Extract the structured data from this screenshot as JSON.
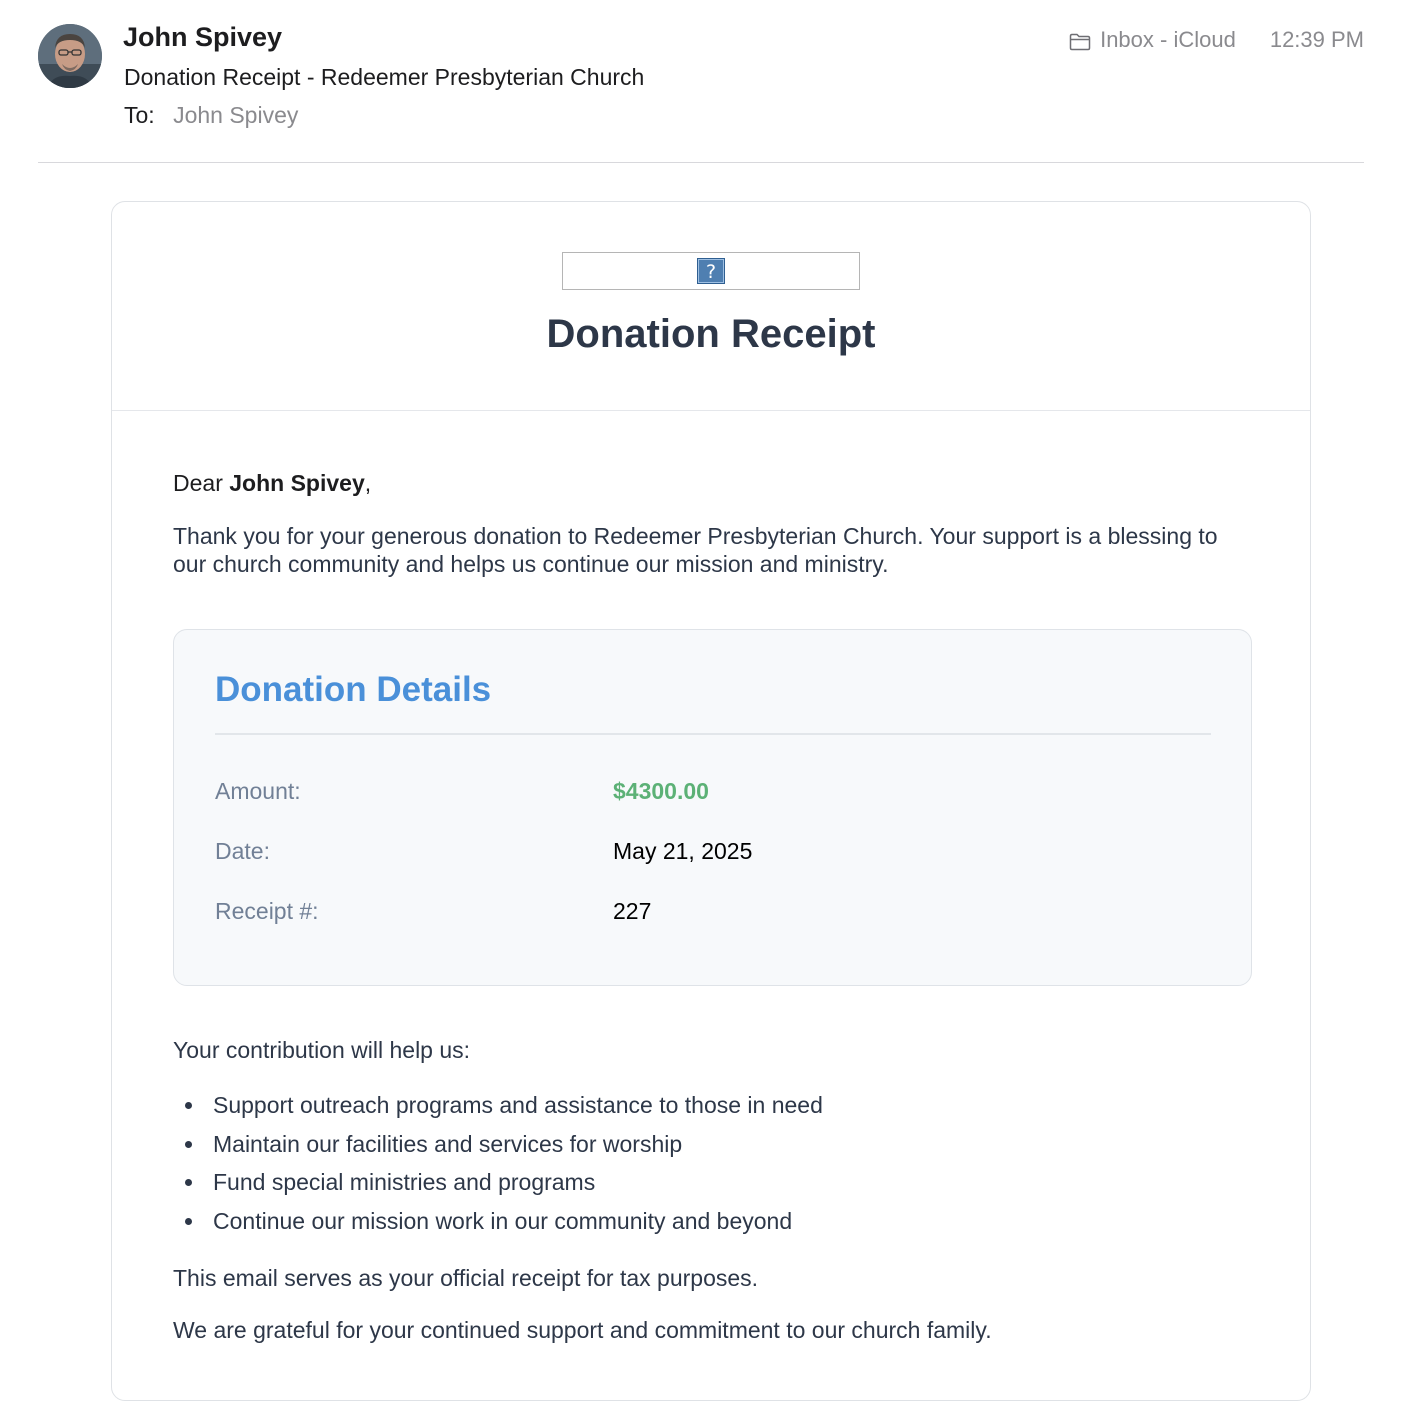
{
  "message": {
    "sender_name": "John Spivey",
    "subject": "Donation Receipt - Redeemer Presbyterian Church",
    "to_label": "To:",
    "to_value": "John Spivey",
    "mailbox": "Inbox - iCloud",
    "time": "12:39 PM"
  },
  "icons": {
    "avatar": "avatar",
    "folder": "folder-icon",
    "broken_image": "broken-image-icon"
  },
  "receipt": {
    "broken_image_glyph": "?",
    "title": "Donation Receipt",
    "greeting_prefix": "Dear ",
    "greeting_name": "John Spivey",
    "greeting_suffix": ",",
    "intro": "Thank you for your generous donation to Redeemer Presbyterian Church. Your support is a blessing to our church community and helps us continue our mission and ministry.",
    "details": {
      "title": "Donation Details",
      "rows": [
        {
          "label": "Amount:",
          "value": "$4300.00"
        },
        {
          "label": "Date:",
          "value": "May 21, 2025"
        },
        {
          "label": "Receipt #:",
          "value": "227"
        }
      ]
    },
    "help_intro": "Your contribution will help us:",
    "help_items": [
      "Support outreach programs and assistance to those in need",
      "Maintain our facilities and services for worship",
      "Fund special ministries and programs",
      "Continue our mission work in our community and beyond"
    ],
    "tax_note": "This email serves as your official receipt for tax purposes.",
    "closing": "We are grateful for your continued support and commitment to our church family."
  },
  "colors": {
    "title": "#2d3748",
    "details_title": "#4a90d9",
    "amount": "#5cb176",
    "label": "#718096",
    "meta_gray": "#8a8a8e"
  }
}
